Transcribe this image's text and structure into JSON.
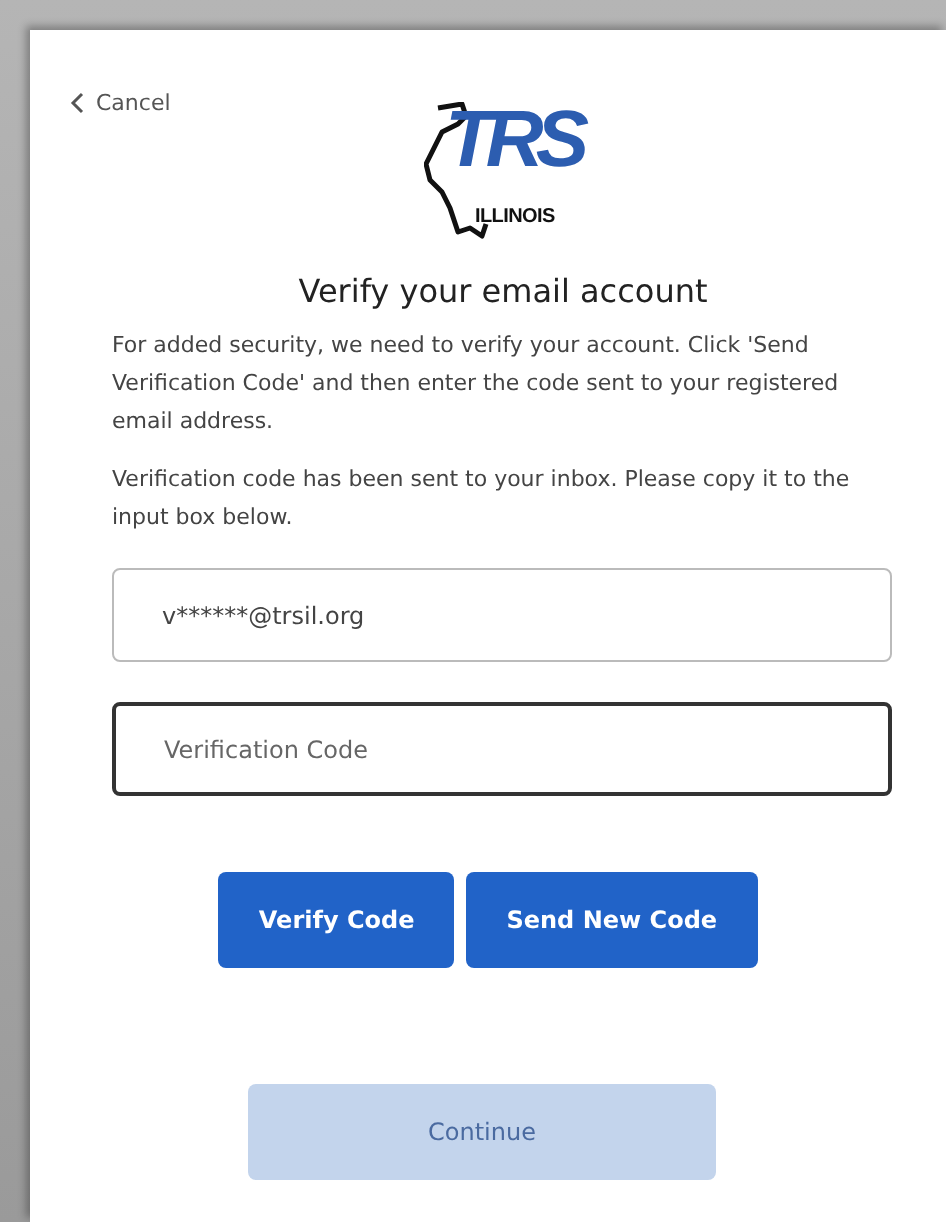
{
  "cancel_link": {
    "label": "Cancel"
  },
  "logo": {
    "letters": "TRS",
    "caption": "ILLINOIS"
  },
  "title": "Verify your email account",
  "paragraphs": [
    "For added security, we need to verify your account. Click 'Send Verification Code' and then enter the code sent to your registered email address.",
    "Verification code has been sent to your inbox. Please copy it to the input box below."
  ],
  "fields": [
    {
      "value": "v******@trsil.org",
      "focused": false
    },
    {
      "placeholder": "Verification Code",
      "focused": true
    }
  ],
  "buttons": [
    {
      "label": "Verify Code",
      "disabled": false
    },
    {
      "label": "Send New Code",
      "disabled": false
    }
  ],
  "continue_button": {
    "label": "Continue",
    "disabled": true
  }
}
